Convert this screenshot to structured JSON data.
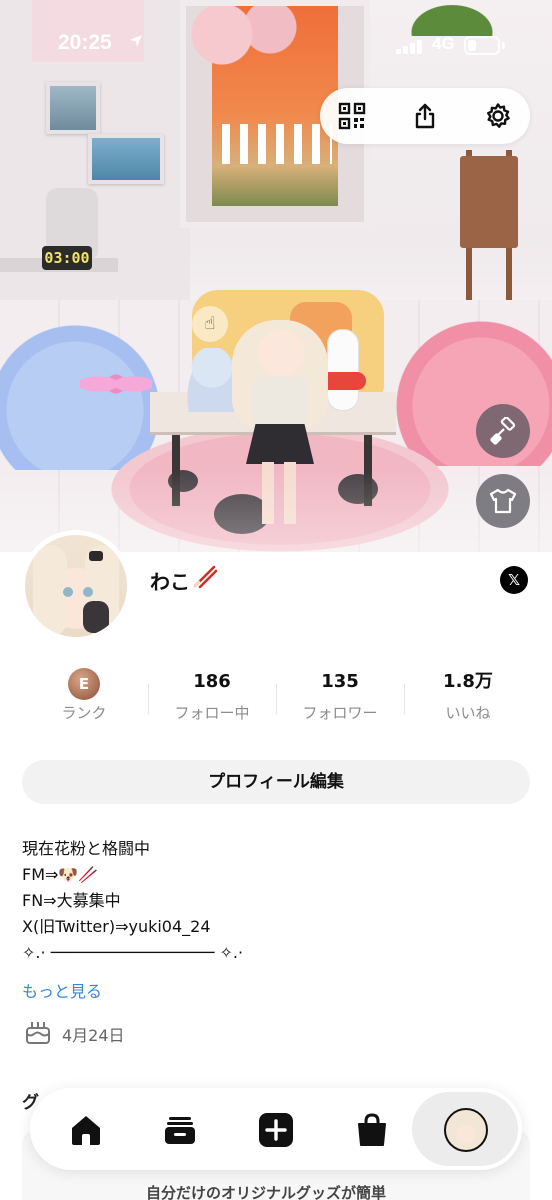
{
  "status_bar": {
    "time": "20:25",
    "network": "4G",
    "battery_level": 0.3
  },
  "hero": {
    "clock_display": "03:00",
    "action_icons": [
      "qr-code-icon",
      "share-icon",
      "gear-icon"
    ],
    "side_icons": [
      "paint-roller-icon",
      "tshirt-icon"
    ]
  },
  "profile": {
    "name": "わこ",
    "name_emoji": "chopsticks",
    "x_link_label": "𝕏"
  },
  "stats": {
    "rank": {
      "badge": "E",
      "label": "ランク"
    },
    "following": {
      "value": "186",
      "label": "フォロー中"
    },
    "followers": {
      "value": "135",
      "label": "フォロワー"
    },
    "likes": {
      "value": "1.8万",
      "label": "いいね"
    }
  },
  "edit_profile_label": "プロフィール編集",
  "bio": {
    "lines": [
      "現在花粉と格闘中",
      "FM⇒🐶🥢",
      "FN⇒大募集中",
      "X(旧Twitter)⇒yuki04_24",
      "✧.· ───────────────── ✧.·"
    ],
    "more_label": "もっと見る"
  },
  "birthday": "4月24日",
  "goods": {
    "section_title": "グ",
    "banner_text": "自分だけのオリジナルグッズが簡単"
  },
  "tabbar": {
    "items": [
      "home-icon",
      "wallet-icon",
      "plus-icon",
      "shopping-bag-icon",
      "profile-avatar"
    ],
    "active_index": 4
  },
  "colors": {
    "link": "#3a85d8",
    "rank_badge": "#a26a50",
    "button_bg": "#f2f2f2"
  }
}
